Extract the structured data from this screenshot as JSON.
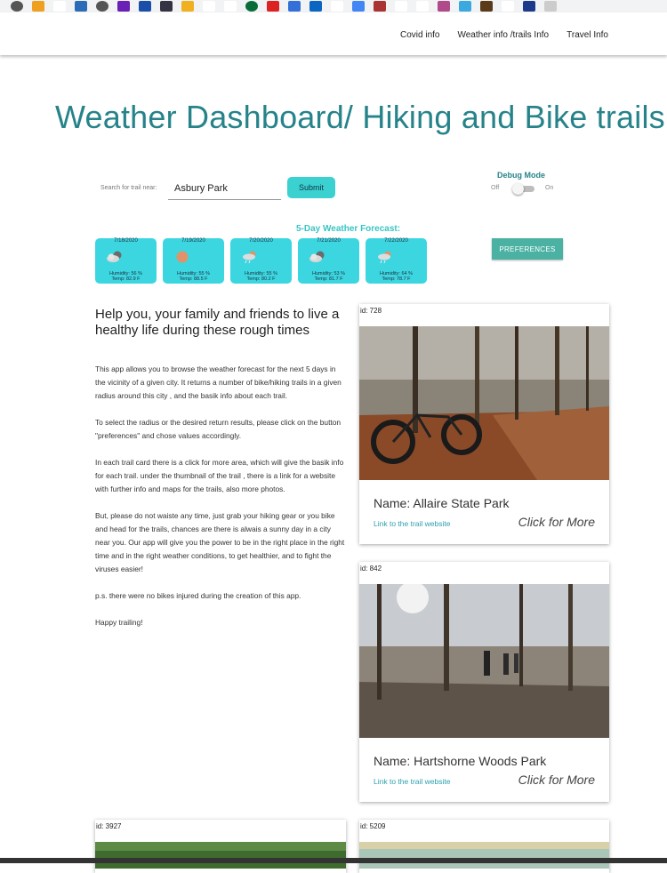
{
  "nav": {
    "links": [
      "Covid info",
      "Weather info /trails Info",
      "Travel Info"
    ]
  },
  "page": {
    "title": "Weather Dashboard/ Hiking and Bike trails"
  },
  "search": {
    "label": "Search for trail near:",
    "value": "Asbury Park",
    "submit_label": "Submit"
  },
  "debug": {
    "title": "Debug Mode",
    "off_label": "Off",
    "on_label": "On",
    "enabled": false
  },
  "forecast": {
    "title": "5-Day Weather Forecast:",
    "days": [
      {
        "date": "7/18/2020",
        "icon": "cloudy-icon",
        "humidity": "Humidity: 56 %",
        "temp": "Temp: 82.9 F"
      },
      {
        "date": "7/19/2020",
        "icon": "sun-icon",
        "humidity": "Humidity: 55 %",
        "temp": "Temp: 88.5 F"
      },
      {
        "date": "7/20/2020",
        "icon": "rain-icon",
        "humidity": "Humidity: 55 %",
        "temp": "Temp: 80.2 F"
      },
      {
        "date": "7/21/2020",
        "icon": "cloudy-icon",
        "humidity": "Humidity: 53 %",
        "temp": "Temp: 81.7 F"
      },
      {
        "date": "7/22/2020",
        "icon": "rain-icon",
        "humidity": "Humidity: 64 %",
        "temp": "Temp: 78.7 F"
      }
    ]
  },
  "preferences": {
    "label": "PREFERENCES"
  },
  "intro": {
    "heading": "Help you, your family and friends to live a healthy life during these rough times",
    "paragraphs": [
      "This app allows you to browse the weather forecast for the next 5 days in the vicinity of a given city. It returns a number of bike/hiking trails in a given radius around this city , and the basik info about each trail.",
      "To select the radius or the desired return results, please click on the button \"preferences\" and chose values accordingly.",
      "In each trail card there is a click for more area, which will give the basik info for each trail. under the thumbnail of the trail , there is a link for a website with further info and maps for the trails, also more photos.",
      "But, please do not waiste any time, just grab your hiking gear or you bike and head for the trails, chances are there is alwais a sunny day in a city near you. Our app will give you the power to be in the right place in the right time and in the right weather conditions, to get healthier, and to fight the viruses easier!",
      "p.s. there were no bikes injured during the creation of this app.",
      "Happy trailing!"
    ]
  },
  "trails": [
    {
      "id_text": "id: 728",
      "name": "Name: Allaire State Park",
      "link": "Link to the trail website",
      "more": "Click for More"
    },
    {
      "id_text": "id: 842",
      "name": "Name: Hartshorne Woods Park",
      "link": "Link to the trail website",
      "more": "Click for More"
    },
    {
      "id_text": "id: 3927"
    },
    {
      "id_text": "id: 5209"
    }
  ],
  "colors": {
    "accent": "#26838a",
    "card_cyan": "#3bd6e0",
    "button_teal": "#4bb2a3",
    "link": "#2a9fb0"
  }
}
